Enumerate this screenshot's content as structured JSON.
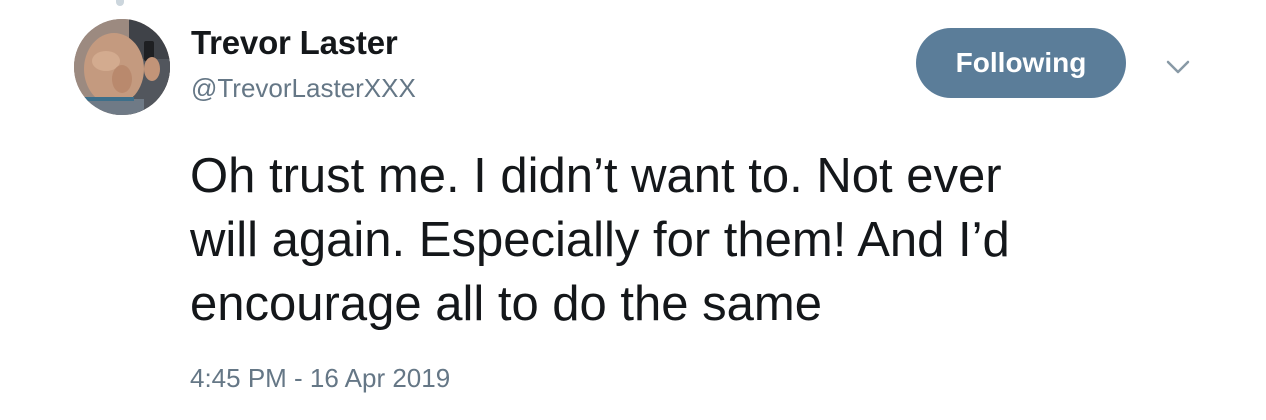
{
  "tweet": {
    "author": {
      "display_name": "Trevor Laster",
      "handle": "@TrevorLasterXXX",
      "avatar_icon": "profile-photo"
    },
    "follow_button_label": "Following",
    "menu_icon": "chevron-down-icon",
    "text": "Oh trust me. I didn’t want to. Not ever\nwill again. Especially for them! And I’d\nencourage all to do the same",
    "timestamp": "4:45 PM - 16 Apr 2019"
  },
  "colors": {
    "follow_button_bg": "#5b7d99",
    "secondary_text": "#657786",
    "primary_text": "#14171a"
  }
}
